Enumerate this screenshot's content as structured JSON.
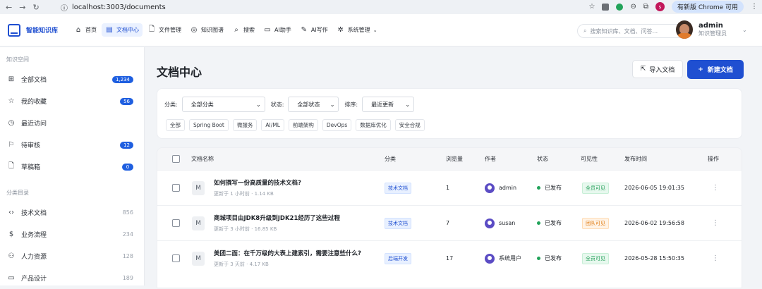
{
  "browser": {
    "url": "localhost:3003/documents",
    "update_label": "有新版 Chrome 可用",
    "profile_initial": "s"
  },
  "app": {
    "name": "智能知识库",
    "nav": [
      {
        "label": "首页",
        "icon": "home-icon"
      },
      {
        "label": "文档中心",
        "icon": "document-icon",
        "active": true
      },
      {
        "label": "文件管理",
        "icon": "file-icon"
      },
      {
        "label": "知识图谱",
        "icon": "graph-icon"
      },
      {
        "label": "搜索",
        "icon": "search-icon"
      },
      {
        "label": "AI助手",
        "icon": "chat-icon"
      },
      {
        "label": "AI写作",
        "icon": "pen-icon"
      },
      {
        "label": "系统管理",
        "icon": "gear-icon"
      }
    ],
    "search_placeholder": "搜索知识库、文档、问答...",
    "user": {
      "name": "admin",
      "role": "知识管理员"
    }
  },
  "sidebar": {
    "section1": "知识空间",
    "items": [
      {
        "label": "全部文档",
        "badge": "1,234",
        "icon": "grid-icon"
      },
      {
        "label": "我的收藏",
        "badge": "56",
        "icon": "star-icon"
      },
      {
        "label": "最近访问",
        "badge": "",
        "icon": "clock-icon"
      },
      {
        "label": "待审核",
        "badge": "12",
        "icon": "bookmark-icon"
      },
      {
        "label": "草稿箱",
        "badge": "0",
        "icon": "draft-icon"
      }
    ],
    "section2": "分类目录",
    "categories": [
      {
        "label": "技术文档",
        "count": "856",
        "icon": "code-icon"
      },
      {
        "label": "业务流程",
        "count": "234",
        "icon": "dollar-icon"
      },
      {
        "label": "人力资源",
        "count": "128",
        "icon": "people-icon"
      },
      {
        "label": "产品设计",
        "count": "189",
        "icon": "monitor-icon"
      }
    ]
  },
  "main": {
    "title": "文档中心",
    "import_label": "导入文档",
    "new_label": "新建文档",
    "filters": {
      "category_label": "分类:",
      "category_value": "全部分类",
      "status_label": "状态:",
      "status_value": "全部状态",
      "sort_label": "排序:",
      "sort_value": "最近更新"
    },
    "chips": [
      "全部",
      "Spring Boot",
      "微服务",
      "AI/ML",
      "前端架构",
      "DevOps",
      "数据库优化",
      "安全合规"
    ],
    "columns": {
      "name": "文档名称",
      "category": "分类",
      "views": "浏览量",
      "author": "作者",
      "status": "状态",
      "visibility": "可见性",
      "published": "发布时间",
      "actions": "操作"
    },
    "rows": [
      {
        "title": "如何撰写一份高质量的技术文档?",
        "updated": "更新于 1 小时前",
        "size": "1.14 KB",
        "category": "技术文档",
        "views": "1",
        "author": "admin",
        "status": "已发布",
        "visibility": "全员可见",
        "vis_color": "green",
        "time": "2026-06-05 19:01:35"
      },
      {
        "title": "商城项目由JDK8升级到JDK21经历了这些过程",
        "updated": "更新于 3 小时前",
        "size": "16.85 KB",
        "category": "技术文档",
        "views": "7",
        "author": "susan",
        "status": "已发布",
        "visibility": "团队可见",
        "vis_color": "orange",
        "time": "2026-06-02 19:56:58"
      },
      {
        "title": "美团二面：在千万级的大表上建索引，需要注意些什么?",
        "updated": "更新于 3 天前",
        "size": "4.17 KB",
        "category": "后端开发",
        "views": "17",
        "author": "系统用户",
        "status": "已发布",
        "visibility": "全员可见",
        "vis_color": "green",
        "time": "2026-05-28 15:50:35"
      }
    ]
  }
}
